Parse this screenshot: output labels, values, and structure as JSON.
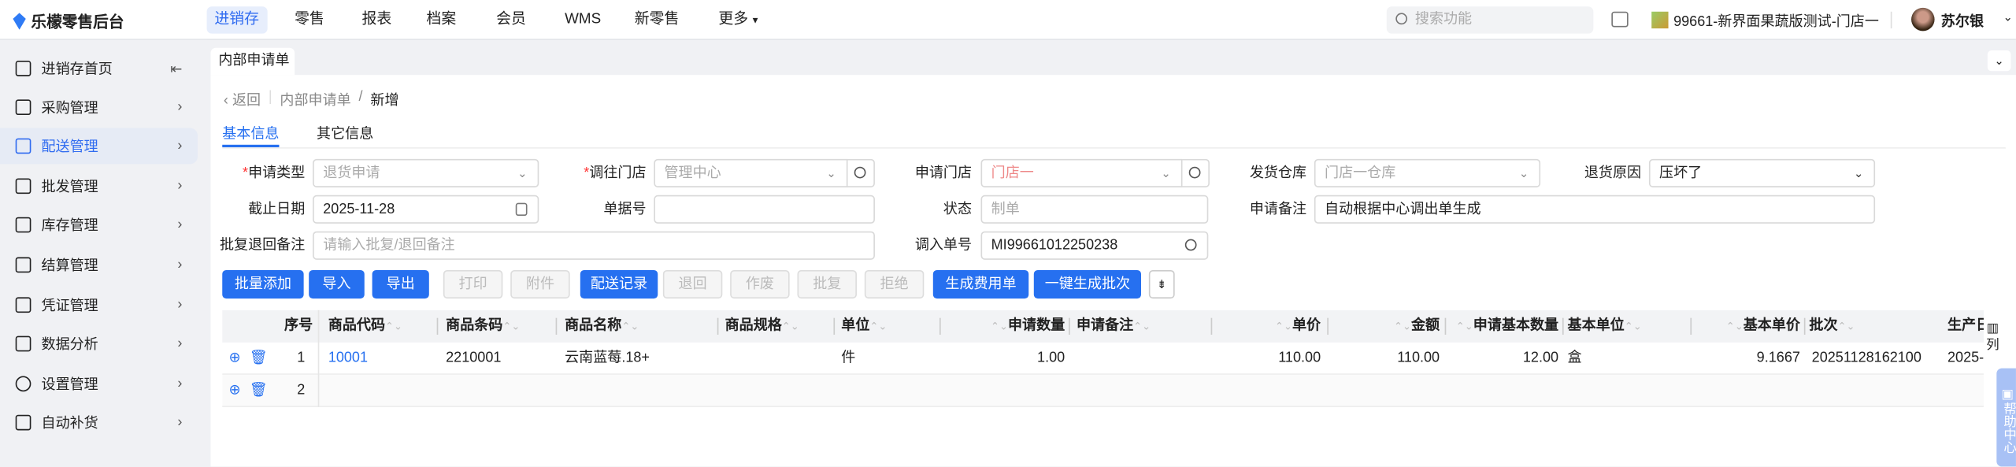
{
  "app": {
    "brand": "乐檬零售后台"
  },
  "nav": [
    "进销存",
    "零售",
    "报表",
    "档案",
    "会员",
    "WMS",
    "新零售",
    "更多"
  ],
  "search_placeholder": "搜索功能",
  "store": "99661-新界面果蔬版测试-门店一",
  "user": "苏尔银",
  "sidebar": [
    {
      "label": "进销存首页",
      "icon": "home-icon"
    },
    {
      "label": "采购管理",
      "icon": "cart-icon"
    },
    {
      "label": "配送管理",
      "icon": "box-icon"
    },
    {
      "label": "批发管理",
      "icon": "wholesale-icon"
    },
    {
      "label": "库存管理",
      "icon": "inventory-icon"
    },
    {
      "label": "结算管理",
      "icon": "settle-icon"
    },
    {
      "label": "凭证管理",
      "icon": "voucher-icon"
    },
    {
      "label": "数据分析",
      "icon": "chart-icon"
    },
    {
      "label": "设置管理",
      "icon": "settings-icon"
    },
    {
      "label": "自动补货",
      "icon": "restock-icon"
    }
  ],
  "page_tab": "内部申请单",
  "breadcrumb": {
    "back": "返回",
    "parent": "内部申请单",
    "sep": "/",
    "current": "新增"
  },
  "tabs": [
    "基本信息",
    "其它信息"
  ],
  "form": {
    "apply_type": {
      "label": "申请类型",
      "value": "退货申请"
    },
    "to_store": {
      "label": "调往门店",
      "value": "管理中心"
    },
    "apply_store": {
      "label": "申请门店",
      "value": "门店一"
    },
    "ship_wh": {
      "label": "发货仓库",
      "value": "门店一仓库"
    },
    "return_reason": {
      "label": "退货原因",
      "value": "压坏了"
    },
    "deadline": {
      "label": "截止日期",
      "value": "2025-11-28"
    },
    "doc_no": {
      "label": "单据号",
      "value": ""
    },
    "status": {
      "label": "状态",
      "value": "制单"
    },
    "remark": {
      "label": "申请备注",
      "value": "自动根据中心调出单生成"
    },
    "reply_remark": {
      "label": "批复退回备注",
      "placeholder": "请输入批复/退回备注"
    },
    "in_no": {
      "label": "调入单号",
      "value": "MI99661012250238"
    }
  },
  "buttons": [
    "批量添加",
    "导入",
    "导出",
    "打印",
    "附件",
    "配送记录",
    "退回",
    "作废",
    "批复",
    "拒绝",
    "生成费用单",
    "一键生成批次"
  ],
  "table": {
    "headers": [
      "序号",
      "商品代码",
      "商品条码",
      "商品名称",
      "商品规格",
      "单位",
      "申请数量",
      "申请备注",
      "单价",
      "金额",
      "申请基本数量",
      "基本单位",
      "基本单价",
      "批次",
      "生产日期"
    ],
    "rows": [
      {
        "no": "1",
        "code": "10001",
        "barcode": "2210001",
        "name": "云南蓝莓.18+",
        "spec": "",
        "unit": "件",
        "qty": "1.00",
        "remark": "",
        "price": "110.00",
        "amount": "110.00",
        "base_qty": "12.00",
        "base_unit": "盒",
        "base_price": "9.1667",
        "batch": "20251128162100",
        "prod": "2025-"
      },
      {
        "no": "2"
      }
    ]
  },
  "column_setting": "列",
  "help": "帮助中心",
  "colors": {
    "primary": "#2670f0",
    "required": "#ff3333"
  }
}
